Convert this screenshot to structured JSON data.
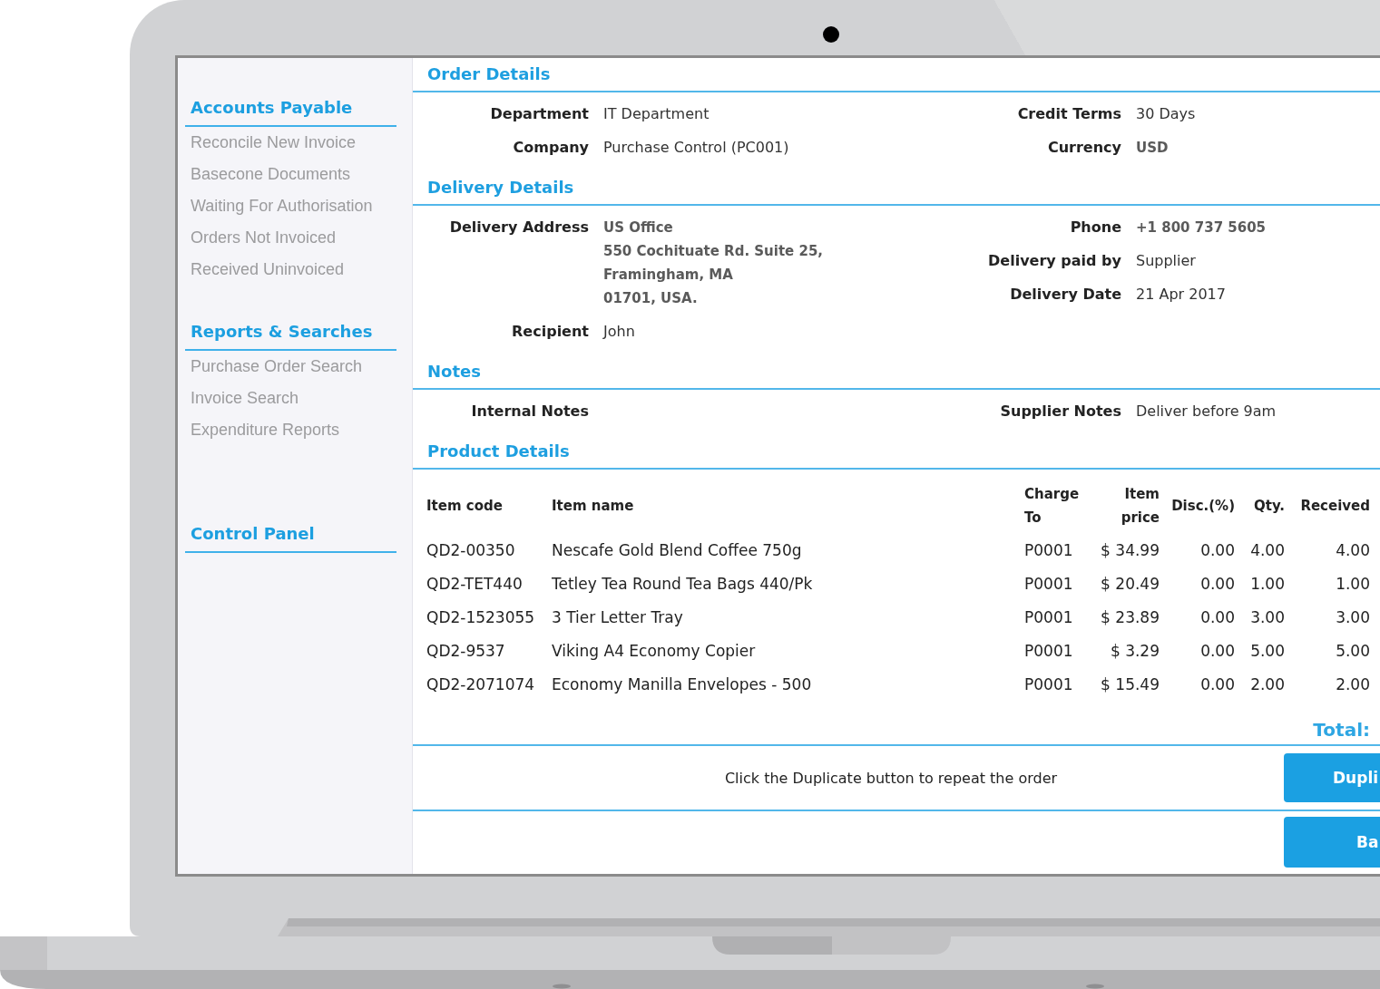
{
  "sidebar": {
    "sections": [
      {
        "heading": "Accounts Payable",
        "items": [
          "Reconcile New Invoice",
          "Basecone Documents",
          "Waiting For Authorisation",
          "Orders Not Invoiced",
          "Received Uninvoiced"
        ]
      },
      {
        "heading": "Reports & Searches",
        "items": [
          "Purchase Order Search",
          "Invoice Search",
          "Expenditure Reports"
        ]
      },
      {
        "heading": "Control Panel"
      }
    ]
  },
  "sections": [
    {
      "title": "Order Details",
      "left": [
        {
          "label": "Department",
          "lines": [
            "IT Department"
          ],
          "bold": false
        },
        {
          "label": "Company",
          "lines": [
            "Purchase Control (PC001)"
          ],
          "bold": false
        }
      ],
      "right": [
        {
          "label": "Credit Terms",
          "lines": [
            "30 Days"
          ],
          "bold": false
        },
        {
          "label": "Currency",
          "lines": [
            "USD"
          ],
          "bold": true
        }
      ]
    },
    {
      "title": "Delivery Details",
      "left": [
        {
          "label": "Delivery Address",
          "lines": [
            "US Office",
            "550 Cochituate Rd. Suite 25,",
            "Framingham, MA",
            "01701, USA."
          ],
          "bold": true
        },
        {
          "label": "Recipient",
          "lines": [
            "John"
          ],
          "bold": false
        }
      ],
      "right": [
        {
          "label": "Phone",
          "lines": [
            "+1 800 737 5605"
          ],
          "bold": true
        },
        {
          "label": "Delivery paid by",
          "lines": [
            "Supplier"
          ],
          "bold": false
        },
        {
          "label": "Delivery Date",
          "lines": [
            "21 Apr 2017"
          ],
          "bold": false
        }
      ]
    },
    {
      "title": "Notes",
      "left": [
        {
          "label": "Internal Notes"
        }
      ],
      "right": [
        {
          "label": "Supplier Notes",
          "lines": [
            "Deliver before 9am"
          ],
          "bold": false
        }
      ]
    }
  ],
  "product_details": {
    "title": "Product Details",
    "columns": [
      "Item code",
      "Item name",
      "Charge To",
      "Item price",
      "Disc.(%)",
      "Qty.",
      "Received"
    ],
    "rows": [
      [
        "QD2-00350",
        "Nescafe Gold Blend Coffee 750g",
        "P0001",
        "$ 34.99",
        "0.00",
        "4.00",
        "4.00"
      ],
      [
        "QD2-TET440",
        "Tetley Tea Round Tea Bags 440/Pk",
        "P0001",
        "$ 20.49",
        "0.00",
        "1.00",
        "1.00"
      ],
      [
        "QD2-1523055",
        "3 Tier Letter Tray",
        "P0001",
        "$ 23.89",
        "0.00",
        "3.00",
        "3.00"
      ],
      [
        "QD2-9537",
        "Viking A4 Economy Copier",
        "P0001",
        "$ 3.29",
        "0.00",
        "5.00",
        "5.00"
      ],
      [
        "QD2-2071074",
        "Economy Manilla Envelopes - 500",
        "P0001",
        "$ 15.49",
        "0.00",
        "2.00",
        "2.00"
      ]
    ],
    "total_label": "Total:"
  },
  "footer": {
    "message": "Click the Duplicate button to repeat the order",
    "buttons": [
      "Dupli",
      "Ba"
    ]
  }
}
